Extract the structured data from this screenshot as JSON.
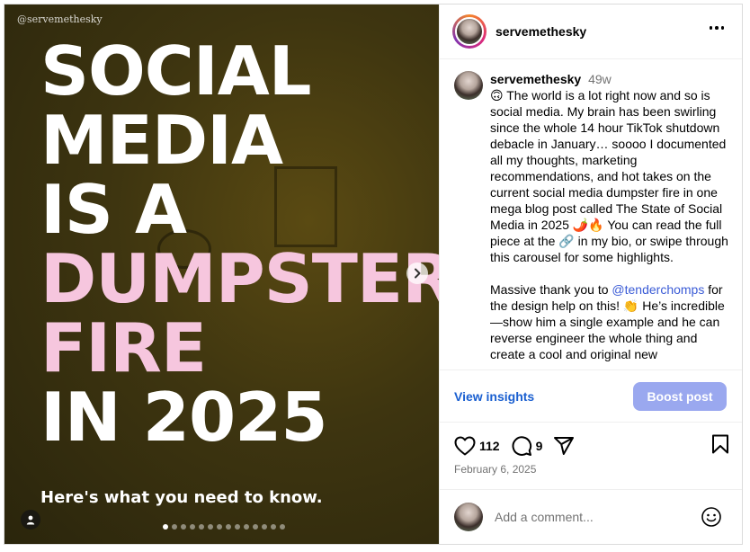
{
  "media": {
    "watermark": "@servemethesky",
    "headline_lines": [
      "SOCIAL",
      "MEDIA",
      "IS A",
      "DUMPSTER",
      "FIRE",
      "IN 2025"
    ],
    "subline": "Here's what you need to know.",
    "carousel": {
      "total": 14,
      "active": 1
    },
    "highlight_color": "#f6c6de"
  },
  "header": {
    "username": "servemethesky",
    "more_icon": "more-horizontal-icon"
  },
  "caption": {
    "username": "servemethesky",
    "timestamp": "49w",
    "para1": "🙃 The world is a lot right now and so is social media. My brain has been swirling since the whole 14 hour TikTok shutdown debacle in January… soooo I documented all my thoughts, marketing recommendations, and hot takes on the current social media dumpster fire in one mega blog post called The State of Social Media in 2025 🌶️🔥 You can read the full piece at the 🔗 in my bio, or swipe through this carousel for some highlights.",
    "para2_before": "Massive thank you to ",
    "para2_mention": "@tenderchomps",
    "para2_after": " for the design help on this! 👏 He’s incredible—show him a single example and he can reverse engineer the whole thing and create a cool and original new"
  },
  "insights": {
    "view_label": "View insights",
    "boost_label": "Boost post",
    "boost_color": "#9aa8ef"
  },
  "actions": {
    "likes": "112",
    "comments": "9",
    "date": "February 6, 2025"
  },
  "comment": {
    "placeholder": "Add a comment..."
  }
}
